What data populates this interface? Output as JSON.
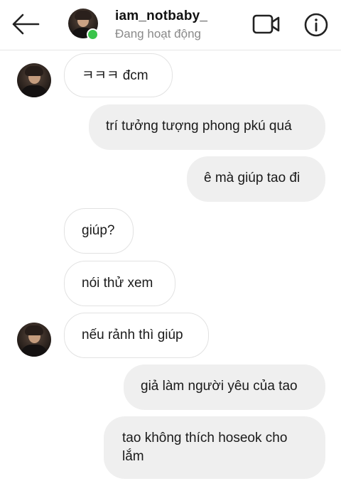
{
  "header": {
    "username": "iam_notbaby_",
    "status": "Đang hoạt động"
  },
  "messages": [
    {
      "direction": "in",
      "text": "ㅋㅋㅋ đcm",
      "show_avatar": true
    },
    {
      "direction": "out",
      "text": "trí tưởng tượng phong pkú quá"
    },
    {
      "direction": "out",
      "text": "ê mà giúp tao đi"
    },
    {
      "direction": "in",
      "text": "giúp?",
      "show_avatar": false
    },
    {
      "direction": "in",
      "text": "nói thử xem",
      "show_avatar": false
    },
    {
      "direction": "in",
      "text": "nếu rảnh thì giúp",
      "show_avatar": true
    },
    {
      "direction": "out",
      "text": "giả làm người yêu của tao"
    },
    {
      "direction": "out",
      "text": "tao không thích hoseok cho lắm"
    }
  ],
  "icons": {
    "back": "arrow-left-icon",
    "video": "video-camera-icon",
    "info": "info-circle-icon"
  },
  "colors": {
    "online": "#3ac44b",
    "outgoing_bubble": "#efefef",
    "incoming_border": "#e2e2e2"
  }
}
